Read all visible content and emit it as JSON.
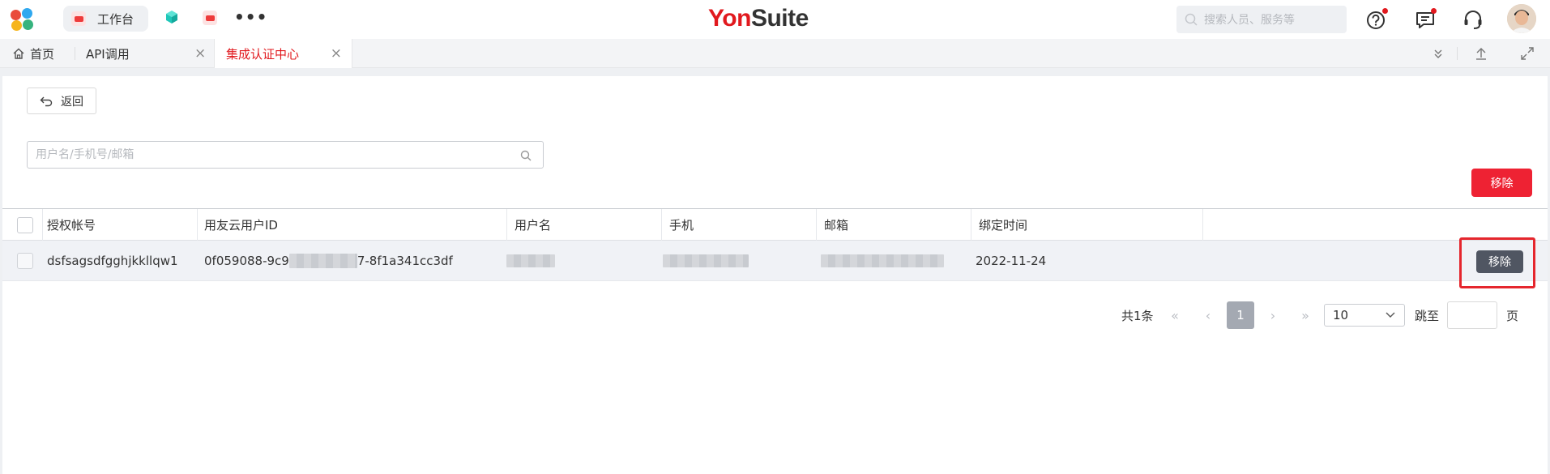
{
  "header": {
    "workbench_label": "工作台",
    "brand_part1": "Yon",
    "brand_part2": "Suite",
    "search_placeholder": "搜索人员、服务等",
    "accent_color": "#e1191e"
  },
  "tabs": [
    {
      "label": "首页"
    },
    {
      "label": "API调用"
    },
    {
      "label": "集成认证中心",
      "active": true
    }
  ],
  "toolbar": {
    "back_label": "返回",
    "search_placeholder": "用户名/手机号/邮箱",
    "remove_label": "移除"
  },
  "table": {
    "columns": [
      "授权帐号",
      "用友云用户ID",
      "用户名",
      "手机",
      "邮箱",
      "绑定时间"
    ],
    "rows": [
      {
        "account": "dsfsagsdfgghjkkllqw1",
        "id_prefix": "0f059088-9c9",
        "id_suffix": "7-8f1a341cc3df",
        "bind_time": "2022-11-24",
        "action_label": "移除"
      }
    ]
  },
  "pagination": {
    "total_text": "共1条",
    "current_page": "1",
    "page_size": "10",
    "jump_label": "跳至",
    "page_unit": "页"
  }
}
